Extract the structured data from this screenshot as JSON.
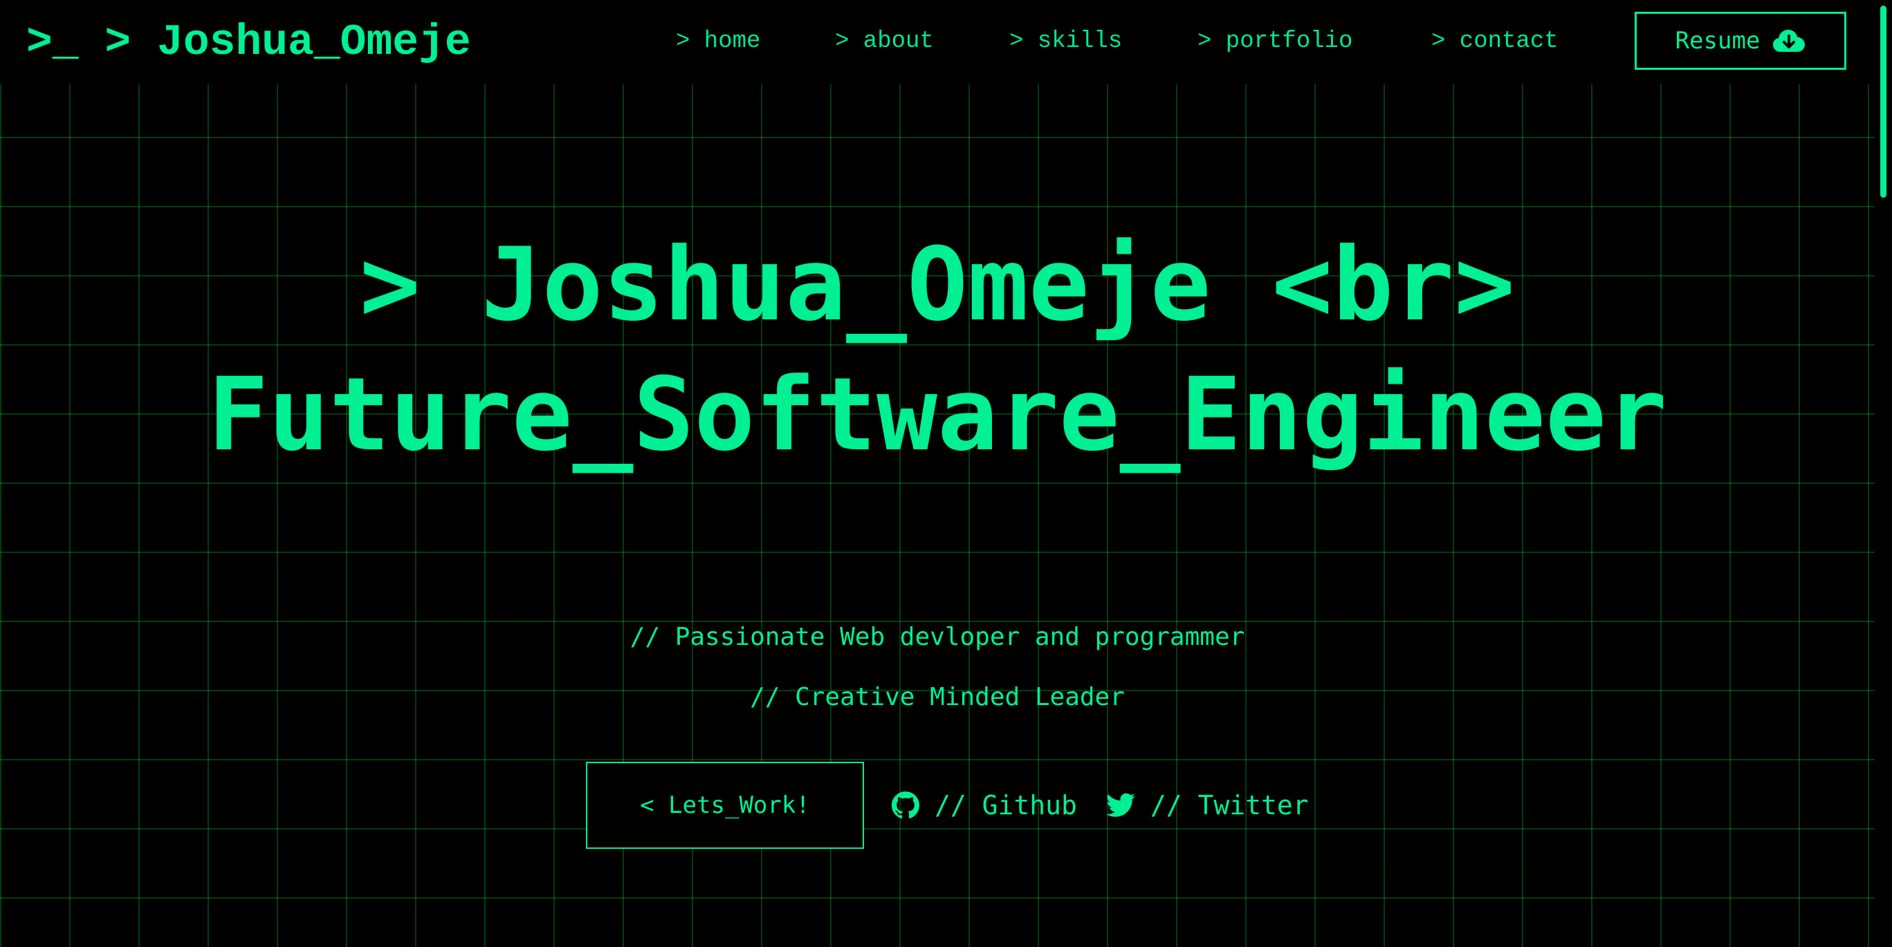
{
  "theme": {
    "accent": "#00f093",
    "background": "#000000",
    "grid_line": "#0b3d17"
  },
  "header": {
    "logo": ">_ > Joshua_Omeje",
    "nav": [
      {
        "label": "> home"
      },
      {
        "label": "> about"
      },
      {
        "label": "> skills"
      },
      {
        "label": "> portfolio"
      },
      {
        "label": "> contact"
      }
    ],
    "resume": {
      "label": "Resume",
      "icon": "cloud-download-icon"
    }
  },
  "hero": {
    "title_line1": "> Joshua_Omeje <br>",
    "title_line2": "Future_Software_Engineer",
    "tagline1": "// Passionate Web devloper and programmer",
    "tagline2": "// Creative Minded Leader"
  },
  "cta": {
    "lets_work": "< Lets_Work!",
    "github": {
      "label": "// Github",
      "icon": "github-icon"
    },
    "twitter": {
      "label": "// Twitter",
      "icon": "twitter-icon"
    }
  }
}
